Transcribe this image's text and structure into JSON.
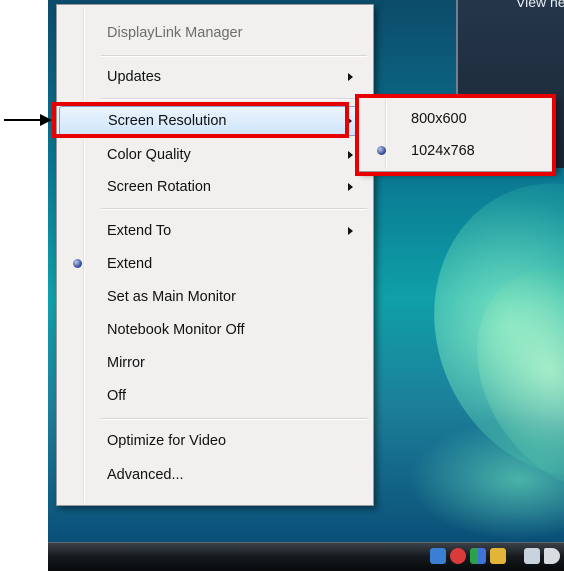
{
  "window": {
    "title": "View hea"
  },
  "menu": {
    "header": "DisplayLink Manager",
    "items": [
      {
        "label": "Updates",
        "submenu": true
      },
      {
        "label": "Screen Resolution",
        "submenu": true,
        "highlighted": true
      },
      {
        "label": "Color Quality",
        "submenu": true
      },
      {
        "label": "Screen Rotation",
        "submenu": true
      },
      {
        "label": "Extend To",
        "submenu": true
      },
      {
        "label": "Extend",
        "checked": true
      },
      {
        "label": "Set as Main Monitor"
      },
      {
        "label": "Notebook Monitor Off"
      },
      {
        "label": "Mirror"
      },
      {
        "label": "Off"
      },
      {
        "label": "Optimize for Video"
      },
      {
        "label": "Advanced..."
      }
    ]
  },
  "submenu": {
    "items": [
      {
        "label": "800x600"
      },
      {
        "label": "1024x768",
        "checked": true
      }
    ]
  },
  "tray": {
    "icons": [
      "network-icon",
      "security-alert-icon",
      "display-icon",
      "usb-icon",
      "monitor-icon",
      "volume-icon"
    ]
  },
  "colors": {
    "highlight_box": "#e80000",
    "menu_bg": "#f1f0ef",
    "radio_dot": "#2a3f8f"
  }
}
